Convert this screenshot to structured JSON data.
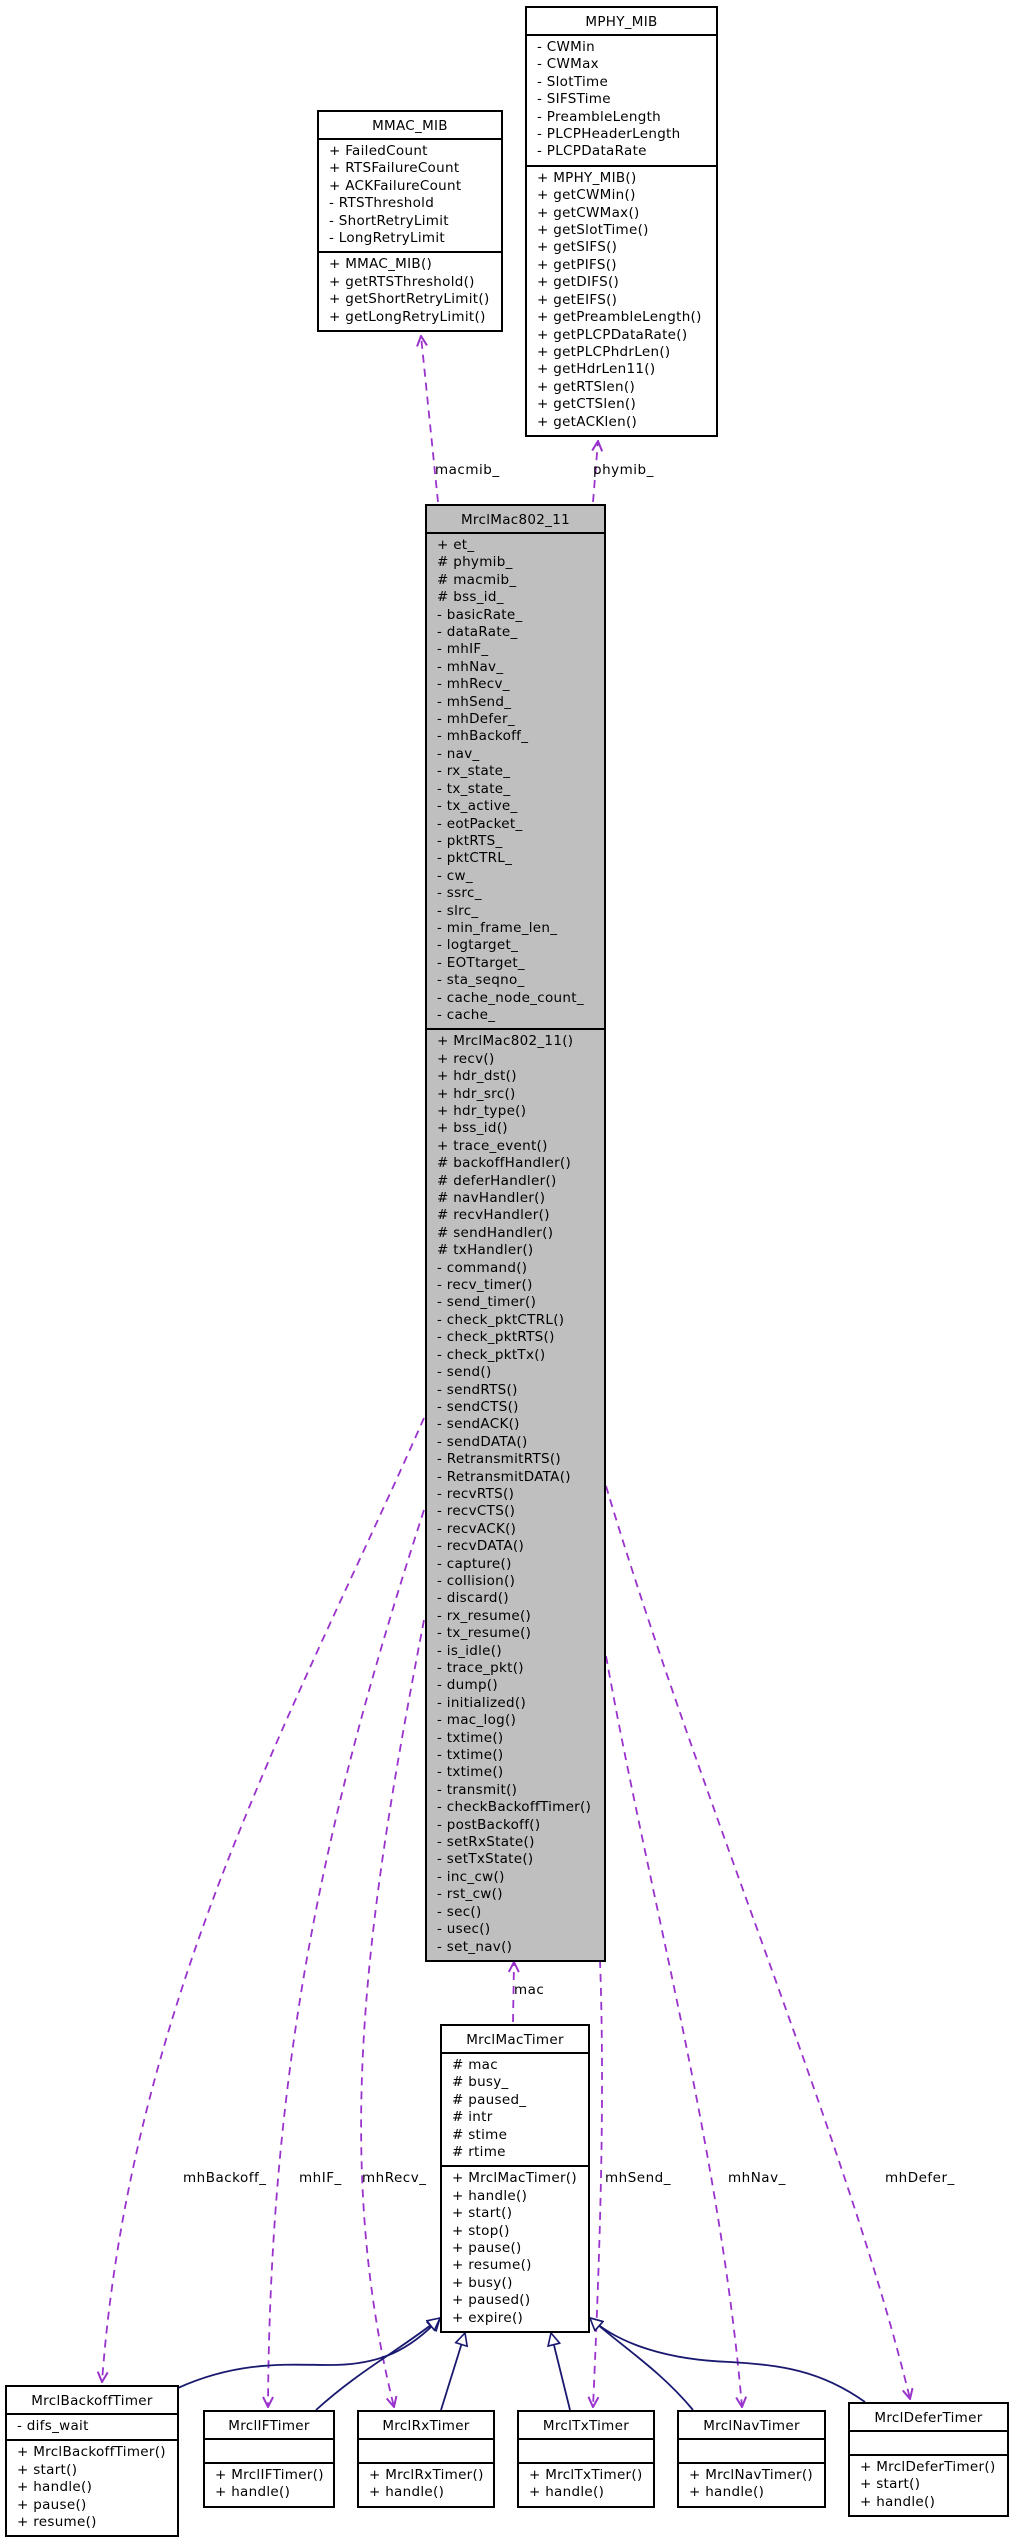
{
  "diagram": {
    "type": "uml-collaboration",
    "colors": {
      "focus_fill": "#bfbfbf",
      "usage_edge": "#9a32cd",
      "inherit_edge": "#191970",
      "border": "#000000"
    },
    "classes": {
      "mmac_mib": {
        "name": "MMAC_MIB",
        "attributes": [
          "+ FailedCount",
          "+ RTSFailureCount",
          "+ ACKFailureCount",
          "- RTSThreshold",
          "- ShortRetryLimit",
          "- LongRetryLimit"
        ],
        "methods": [
          "+ MMAC_MIB()",
          "+ getRTSThreshold()",
          "+ getShortRetryLimit()",
          "+ getLongRetryLimit()"
        ]
      },
      "mphy_mib": {
        "name": "MPHY_MIB",
        "attributes": [
          "- CWMin",
          "- CWMax",
          "- SlotTime",
          "- SIFSTime",
          "- PreambleLength",
          "- PLCPHeaderLength",
          "- PLCPDataRate"
        ],
        "methods": [
          "+ MPHY_MIB()",
          "+ getCWMin()",
          "+ getCWMax()",
          "+ getSlotTime()",
          "+ getSIFS()",
          "+ getPIFS()",
          "+ getDIFS()",
          "+ getEIFS()",
          "+ getPreambleLength()",
          "+ getPLCPDataRate()",
          "+ getPLCPhdrLen()",
          "+ getHdrLen11()",
          "+ getRTSlen()",
          "+ getCTSlen()",
          "+ getACKlen()"
        ]
      },
      "mrclmac802_11": {
        "name": "MrclMac802_11",
        "attributes": [
          "+ et_",
          "# phymib_",
          "# macmib_",
          "# bss_id_",
          "- basicRate_",
          "- dataRate_",
          "- mhIF_",
          "- mhNav_",
          "- mhRecv_",
          "- mhSend_",
          "- mhDefer_",
          "- mhBackoff_",
          "- nav_",
          "- rx_state_",
          "- tx_state_",
          "- tx_active_",
          "- eotPacket_",
          "- pktRTS_",
          "- pktCTRL_",
          "- cw_",
          "- ssrc_",
          "- slrc_",
          "- min_frame_len_",
          "- logtarget_",
          "- EOTtarget_",
          "- sta_seqno_",
          "- cache_node_count_",
          "- cache_"
        ],
        "methods": [
          "+ MrclMac802_11()",
          "+ recv()",
          "+ hdr_dst()",
          "+ hdr_src()",
          "+ hdr_type()",
          "+ bss_id()",
          "+ trace_event()",
          "# backoffHandler()",
          "# deferHandler()",
          "# navHandler()",
          "# recvHandler()",
          "# sendHandler()",
          "# txHandler()",
          "- command()",
          "- recv_timer()",
          "- send_timer()",
          "- check_pktCTRL()",
          "- check_pktRTS()",
          "- check_pktTx()",
          "- send()",
          "- sendRTS()",
          "- sendCTS()",
          "- sendACK()",
          "- sendDATA()",
          "- RetransmitRTS()",
          "- RetransmitDATA()",
          "- recvRTS()",
          "- recvCTS()",
          "- recvACK()",
          "- recvDATA()",
          "- capture()",
          "- collision()",
          "- discard()",
          "- rx_resume()",
          "- tx_resume()",
          "- is_idle()",
          "- trace_pkt()",
          "- dump()",
          "- initialized()",
          "- mac_log()",
          "- txtime()",
          "- txtime()",
          "- txtime()",
          "- transmit()",
          "- checkBackoffTimer()",
          "- postBackoff()",
          "- setRxState()",
          "- setTxState()",
          "- inc_cw()",
          "- rst_cw()",
          "- sec()",
          "- usec()",
          "- set_nav()"
        ]
      },
      "mrclmactimer": {
        "name": "MrclMacTimer",
        "attributes": [
          "# mac",
          "# busy_",
          "# paused_",
          "# intr",
          "# stime",
          "# rtime"
        ],
        "methods": [
          "+ MrclMacTimer()",
          "+ handle()",
          "+ start()",
          "+ stop()",
          "+ pause()",
          "+ resume()",
          "+ busy()",
          "+ paused()",
          "+ expire()"
        ]
      },
      "mrclbackofftimer": {
        "name": "MrclBackoffTimer",
        "attributes": [
          "- difs_wait"
        ],
        "methods": [
          "+ MrclBackoffTimer()",
          "+ start()",
          "+ handle()",
          "+ pause()",
          "+ resume()"
        ]
      },
      "mrcliftimer": {
        "name": "MrclIFTimer",
        "attributes": [],
        "methods": [
          "+ MrclIFTimer()",
          "+ handle()"
        ]
      },
      "mrclrxtimer": {
        "name": "MrclRxTimer",
        "attributes": [],
        "methods": [
          "+ MrclRxTimer()",
          "+ handle()"
        ]
      },
      "mrcltxtimer": {
        "name": "MrclTxTimer",
        "attributes": [],
        "methods": [
          "+ MrclTxTimer()",
          "+ handle()"
        ]
      },
      "mrclnavtimer": {
        "name": "MrclNavTimer",
        "attributes": [],
        "methods": [
          "+ MrclNavTimer()",
          "+ handle()"
        ]
      },
      "mrcldefertimer": {
        "name": "MrclDeferTimer",
        "attributes": [],
        "methods": [
          "+ MrclDeferTimer()",
          "+ start()",
          "+ handle()"
        ]
      }
    },
    "edge_labels": {
      "macmib": "macmib_",
      "phymib": "phymib_",
      "mac": "mac",
      "mhBackoff": "mhBackoff_",
      "mhIF": "mhIF_",
      "mhRecv": "mhRecv_",
      "mhSend": "mhSend_",
      "mhNav": "mhNav_",
      "mhDefer": "mhDefer_"
    },
    "relations": [
      {
        "type": "usage",
        "from": "MrclMac802_11",
        "to": "MMAC_MIB",
        "label": "macmib_"
      },
      {
        "type": "usage",
        "from": "MrclMac802_11",
        "to": "MPHY_MIB",
        "label": "phymib_"
      },
      {
        "type": "usage",
        "from": "MrclMacTimer",
        "to": "MrclMac802_11",
        "label": "mac"
      },
      {
        "type": "usage",
        "from": "MrclMac802_11",
        "to": "MrclBackoffTimer",
        "label": "mhBackoff_"
      },
      {
        "type": "usage",
        "from": "MrclMac802_11",
        "to": "MrclIFTimer",
        "label": "mhIF_"
      },
      {
        "type": "usage",
        "from": "MrclMac802_11",
        "to": "MrclRxTimer",
        "label": "mhRecv_"
      },
      {
        "type": "usage",
        "from": "MrclMac802_11",
        "to": "MrclTxTimer",
        "label": "mhSend_"
      },
      {
        "type": "usage",
        "from": "MrclMac802_11",
        "to": "MrclNavTimer",
        "label": "mhNav_"
      },
      {
        "type": "usage",
        "from": "MrclMac802_11",
        "to": "MrclDeferTimer",
        "label": "mhDefer_"
      },
      {
        "type": "inheritance",
        "from": "MrclBackoffTimer",
        "to": "MrclMacTimer"
      },
      {
        "type": "inheritance",
        "from": "MrclIFTimer",
        "to": "MrclMacTimer"
      },
      {
        "type": "inheritance",
        "from": "MrclRxTimer",
        "to": "MrclMacTimer"
      },
      {
        "type": "inheritance",
        "from": "MrclTxTimer",
        "to": "MrclMacTimer"
      },
      {
        "type": "inheritance",
        "from": "MrclNavTimer",
        "to": "MrclMacTimer"
      },
      {
        "type": "inheritance",
        "from": "MrclDeferTimer",
        "to": "MrclMacTimer"
      }
    ]
  }
}
